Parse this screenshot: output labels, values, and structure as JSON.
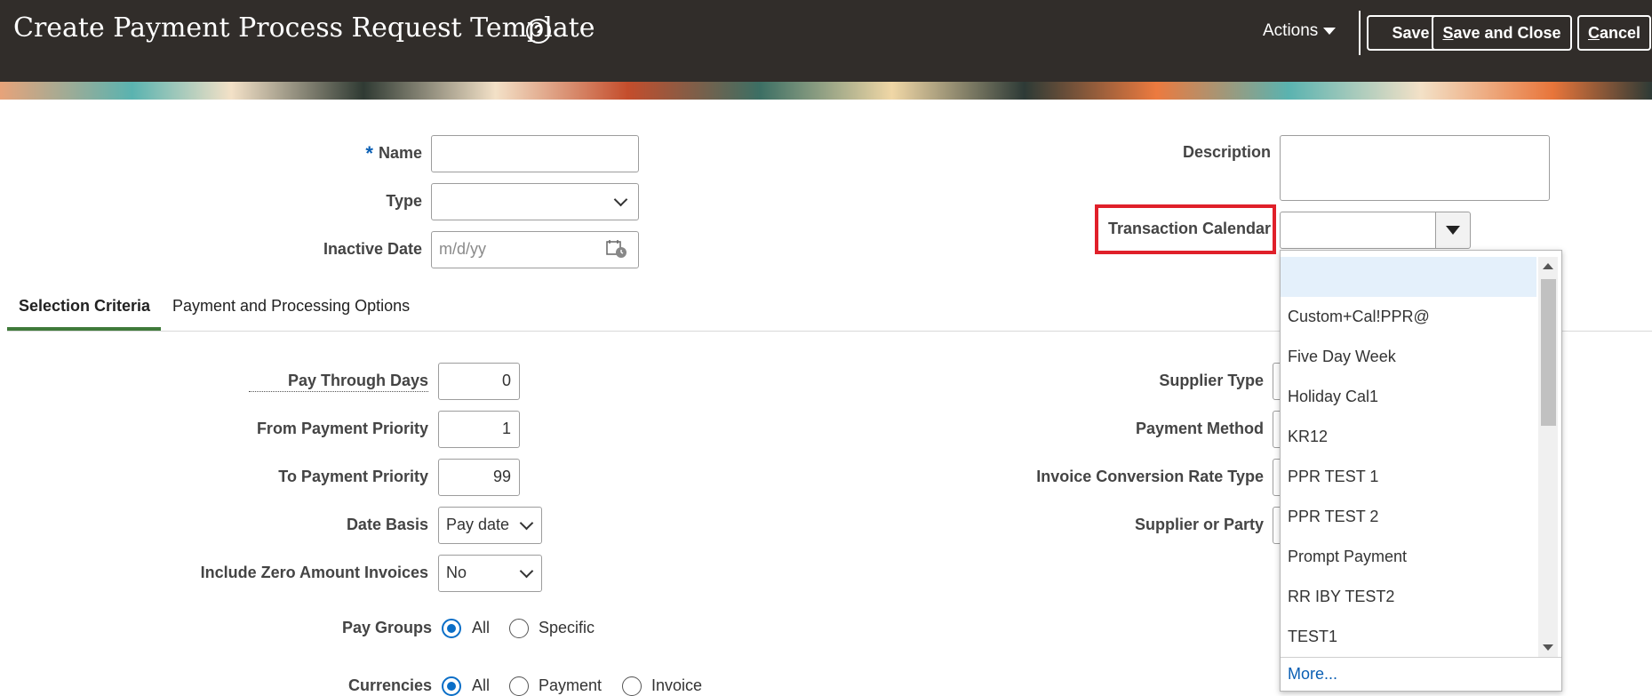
{
  "header": {
    "title": "Create Payment Process Request Template",
    "help_icon": "question-circle-icon",
    "actions_label": "Actions",
    "save_label": "Save",
    "save_close_label": "ave and Close",
    "save_close_mnemonic": "S",
    "cancel_label": "ancel",
    "cancel_mnemonic": "C"
  },
  "form": {
    "name_required_mark": "*",
    "name_label": "Name",
    "name_value": "",
    "type_label": "Type",
    "type_value": "",
    "inactive_date_label": "Inactive Date",
    "inactive_date_placeholder": "m/d/yy",
    "description_label": "Description",
    "description_value": "",
    "transaction_calendar_label": "Transaction Calendar",
    "transaction_calendar_value": ""
  },
  "tabs": [
    {
      "label": "Selection Criteria",
      "active": true
    },
    {
      "label": "Payment and Processing Options",
      "active": false
    }
  ],
  "selection_criteria": {
    "pay_through_days_label": "Pay Through Days",
    "pay_through_days_value": "0",
    "from_priority_label": "From Payment Priority",
    "from_priority_value": "1",
    "to_priority_label": "To Payment Priority",
    "to_priority_value": "99",
    "date_basis_label": "Date Basis",
    "date_basis_value": "Pay date",
    "include_zero_label": "Include Zero Amount Invoices",
    "include_zero_value": "No",
    "pay_groups_label": "Pay Groups",
    "pay_groups_options": [
      "All",
      "Specific"
    ],
    "pay_groups_selected": "All",
    "currencies_label": "Currencies",
    "currencies_options": [
      "All",
      "Payment",
      "Invoice"
    ],
    "currencies_selected": "All",
    "supplier_type_label": "Supplier Type",
    "payment_method_label": "Payment Method",
    "invoice_conversion_label": "Invoice Conversion Rate Type",
    "supplier_or_party_label": "Supplier or Party"
  },
  "calendar_dropdown": {
    "options": [
      "",
      "Custom+Cal!PPR@",
      "Five Day Week",
      "Holiday Cal1",
      "KR12",
      "PPR TEST 1",
      "PPR TEST 2",
      "Prompt Payment",
      "RR IBY TEST2",
      "TEST1"
    ],
    "highlighted_index": 0,
    "more_label": "More..."
  },
  "colors": {
    "header_bg": "#312d2a",
    "highlight_border": "#e0202a",
    "link": "#0a5fb4",
    "active_tab": "#3f7a3a",
    "radio_selected": "#0a6ec7"
  }
}
